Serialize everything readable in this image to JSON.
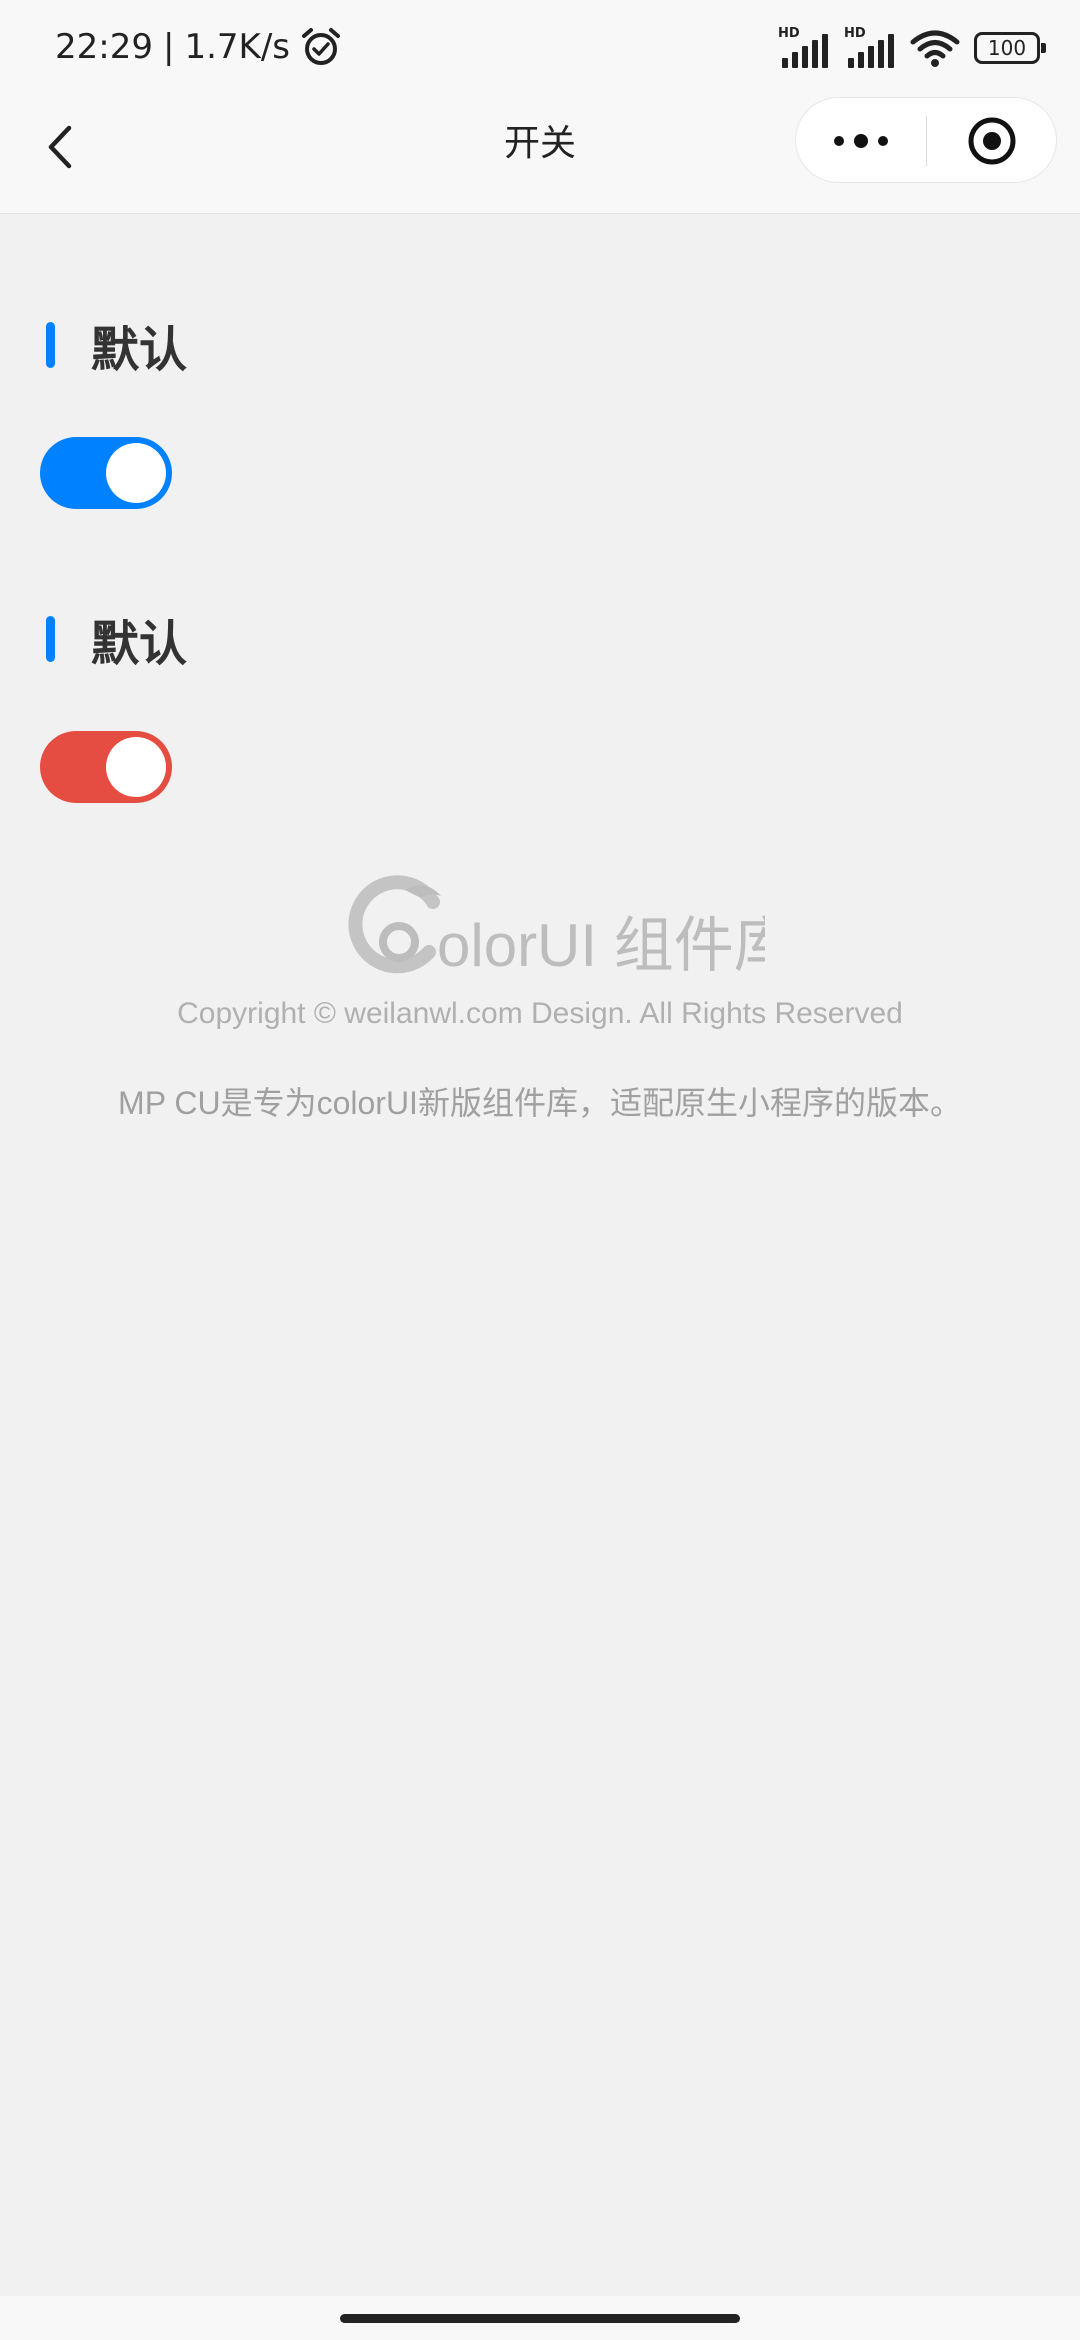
{
  "status_bar": {
    "time": "22:29",
    "speed": "1.7K/s",
    "network_badge_1": "HD",
    "network_badge_2": "HD",
    "battery": "100"
  },
  "navbar": {
    "title": "开关"
  },
  "sections": [
    {
      "title": "默认",
      "switch_on": true,
      "color": "#0081ff"
    },
    {
      "title": "默认",
      "switch_on": true,
      "color": "#e54d42"
    }
  ],
  "footer": {
    "logo_text": "olorUI 组件库",
    "copyright": "Copyright © weilanwl.com Design. All Rights Reserved",
    "description": "MP CU是专为colorUI新版组件库，适配原生小程序的版本。"
  },
  "colors": {
    "accent_blue": "#0081ff",
    "accent_red": "#e54d42",
    "background": "#f1f1f1"
  }
}
